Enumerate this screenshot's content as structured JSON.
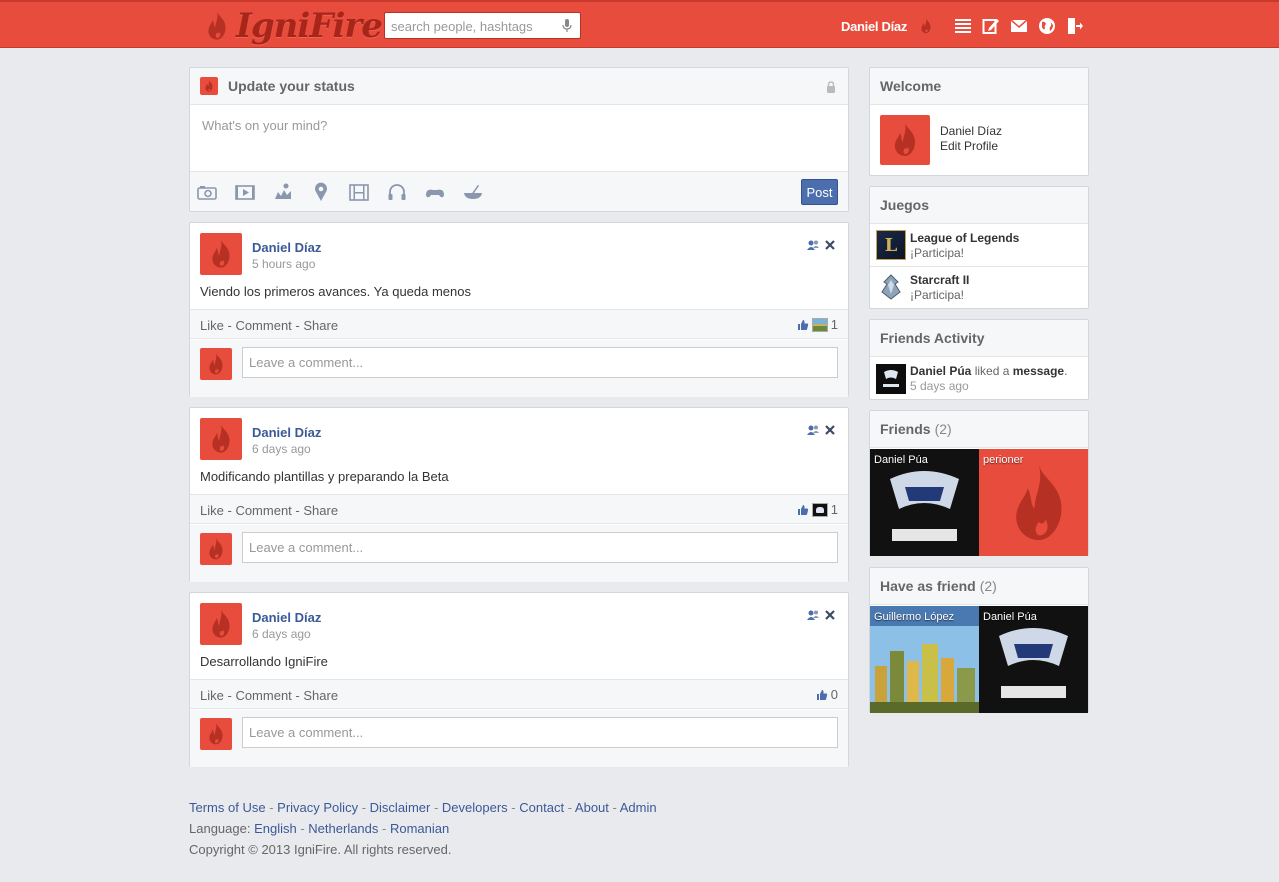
{
  "app": {
    "brand": "IgniFire",
    "accent": "#e84c3d",
    "link_color": "#3b5998"
  },
  "header": {
    "search_placeholder": "search people, hashtags",
    "user_name": "Daniel Díaz",
    "icons": [
      "list-icon",
      "edit-icon",
      "mail-icon",
      "globe-icon",
      "logout-icon"
    ]
  },
  "status": {
    "title": "Update your status",
    "placeholder": "What's on your mind?",
    "tools": [
      "camera-icon",
      "video-icon",
      "thought-icon",
      "location-icon",
      "film-icon",
      "music-icon",
      "game-icon",
      "food-icon"
    ],
    "post_label": "Post"
  },
  "posts": [
    {
      "author": "Daniel Díaz",
      "time": "5 hours ago",
      "text": "Viendo los primeros avances. Ya queda menos",
      "like": "Like",
      "comment": "Comment",
      "share": "Share",
      "likes": "1",
      "comment_placeholder": "Leave a comment..."
    },
    {
      "author": "Daniel Díaz",
      "time": "6 days ago",
      "text": "Modificando plantillas y preparando la Beta",
      "like": "Like",
      "comment": "Comment",
      "share": "Share",
      "likes": "1",
      "comment_placeholder": "Leave a comment..."
    },
    {
      "author": "Daniel Díaz",
      "time": "6 days ago",
      "text": "Desarrollando IgniFire",
      "like": "Like",
      "comment": "Comment",
      "share": "Share",
      "likes": "0",
      "comment_placeholder": "Leave a comment..."
    }
  ],
  "sidebar": {
    "welcome": {
      "title": "Welcome",
      "name": "Daniel Díaz",
      "edit": "Edit Profile"
    },
    "games": {
      "title": "Juegos",
      "items": [
        {
          "name": "League of Legends",
          "cta": "¡Participa!"
        },
        {
          "name": "Starcraft II",
          "cta": "¡Participa!"
        }
      ]
    },
    "activity": {
      "title": "Friends Activity",
      "actor": "Daniel Púa",
      "verb": "liked a",
      "object": "message",
      "tail": ".",
      "time": "5 days ago"
    },
    "friends": {
      "title": "Friends",
      "count": "(2)",
      "items": [
        {
          "name": "Daniel Púa"
        },
        {
          "name": "perioner"
        }
      ]
    },
    "have_as_friend": {
      "title": "Have as friend",
      "count": "(2)",
      "items": [
        {
          "name": "Guillermo López"
        },
        {
          "name": "Daniel Púa"
        }
      ]
    }
  },
  "footer": {
    "links": [
      "Terms of Use",
      "Privacy Policy",
      "Disclaimer",
      "Developers",
      "Contact",
      "About",
      "Admin"
    ],
    "language_label": "Language:",
    "languages": [
      "English",
      "Netherlands",
      "Romanian"
    ],
    "copyright": "Copyright © 2013 IgniFire. All rights reserved."
  }
}
